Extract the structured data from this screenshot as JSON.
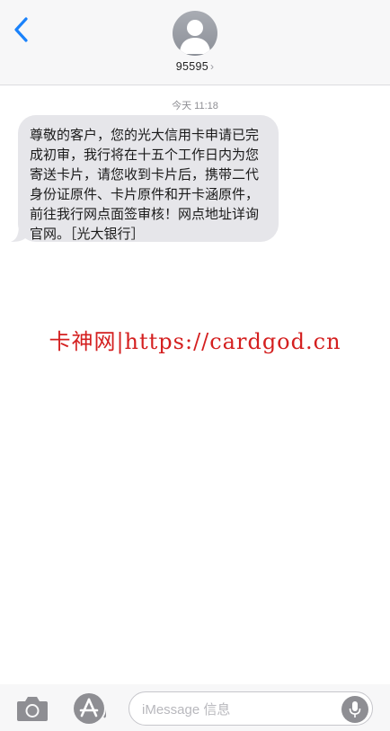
{
  "header": {
    "contact": "95595",
    "chevron": "›"
  },
  "thread": {
    "timestamp": "今天 11:18",
    "messages": [
      {
        "direction": "incoming",
        "text": "尊敬的客户，您的光大信用卡申请已完成初审，我行将在十五个工作日内为您寄送卡片，请您收到卡片后，携带二代身份证原件、卡片原件和开卡涵原件，前往我行网点面签审核！网点地址详询官网。［光大银行］"
      }
    ]
  },
  "watermark": {
    "text": "卡神网|https://cardgod.cn"
  },
  "composer": {
    "placeholder": "iMessage 信息"
  },
  "colors": {
    "accent": "#1a82fb",
    "bubble_incoming": "#e6e6ea",
    "watermark": "#d41f1f"
  },
  "icons": {
    "back": "chevron-left-icon",
    "avatar": "person-silhouette-icon",
    "camera": "camera-icon",
    "apps": "app-store-icon",
    "mic": "microphone-icon"
  }
}
